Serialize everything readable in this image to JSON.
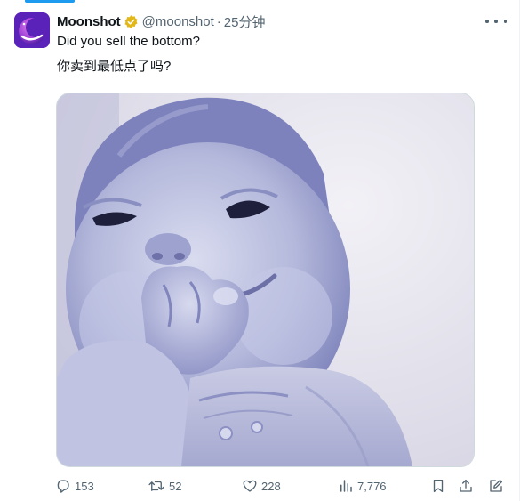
{
  "post": {
    "display_name": "Moonshot",
    "handle": "@moonshot",
    "separator": "·",
    "time": "25分钟",
    "verified_badge_color": "#e2b719",
    "text_line_1": "Did you sell the bottom?",
    "text_line_2": "你卖到最低点了吗?",
    "media_icon": "baby-smiling-photo"
  },
  "actions": {
    "reply_count": "153",
    "retweet_count": "52",
    "like_count": "228",
    "views_count": "7,776"
  },
  "icons": {
    "avatar": "moonshot-logo-icon",
    "more": "more-dots-icon",
    "reply": "reply-icon",
    "retweet": "retweet-icon",
    "like": "heart-icon",
    "views": "views-chart-icon",
    "bookmark": "bookmark-icon",
    "share": "share-icon",
    "edit": "edit-icon"
  },
  "colors": {
    "text_primary": "#0f1419",
    "text_secondary": "#536471",
    "accent": "#1d9bf0",
    "avatar_bg": "#6c2cc4"
  }
}
